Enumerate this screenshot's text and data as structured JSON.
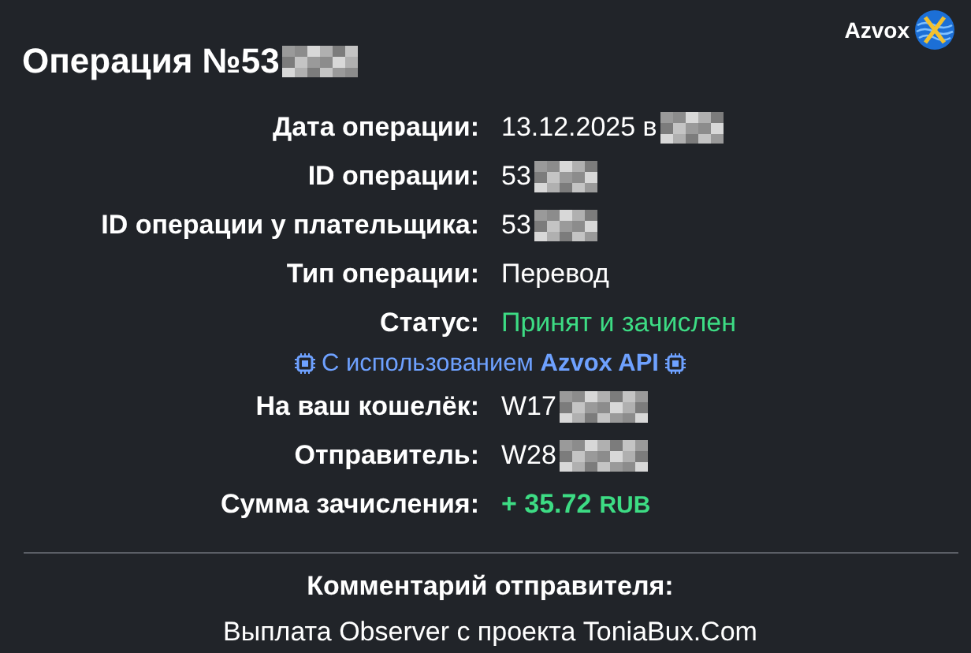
{
  "title": {
    "text": "Операция №53",
    "redacted": true
  },
  "brand": {
    "name": "Azvox"
  },
  "fields": [
    {
      "label": "Дата операции:",
      "value": "13.12.2025 в",
      "kind": "text",
      "redacted": true
    },
    {
      "label": "ID операции:",
      "value": "53",
      "kind": "text",
      "redacted": true
    },
    {
      "label": "ID операции у плательщика:",
      "value": "53",
      "kind": "text",
      "redacted": true
    },
    {
      "label": "Тип операции:",
      "value": "Перевод",
      "kind": "text",
      "redacted": false
    },
    {
      "label": "Статус:",
      "value": "Принят и зачислен",
      "kind": "status",
      "redacted": false
    },
    {
      "kind": "api",
      "text": "С использованием **Azvox API**"
    },
    {
      "label": "На ваш кошелёк:",
      "value": "W17",
      "kind": "text",
      "redacted": true
    },
    {
      "label": "Отправитель:",
      "value": "W28",
      "kind": "text",
      "redacted": true
    },
    {
      "label": "Сумма зачисления:",
      "value": "+ 35.72",
      "currency": "RUB",
      "kind": "amount",
      "redacted": false
    }
  ],
  "comment": {
    "title": "Комментарий отправителя:",
    "text": "Выплата Observer с проекта ToniaBux.Com"
  }
}
